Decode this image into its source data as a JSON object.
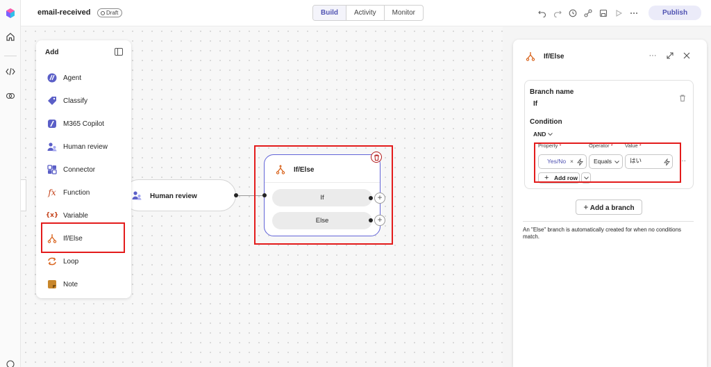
{
  "app": {
    "workflow_name": "email-received",
    "status_badge": "Draft"
  },
  "tabs": [
    {
      "label": "Build",
      "active": true
    },
    {
      "label": "Activity",
      "active": false
    },
    {
      "label": "Monitor",
      "active": false
    }
  ],
  "toolbar": {
    "publish_label": "Publish",
    "icons": [
      "undo-icon",
      "redo-icon",
      "history-icon",
      "connections-icon",
      "save-icon",
      "run-icon",
      "more-icon"
    ]
  },
  "rail": {
    "icons": [
      "app-logo-icon",
      "home-icon",
      "code-icon",
      "library-icon",
      "globe-icon"
    ]
  },
  "add_panel": {
    "title": "Add",
    "items": [
      {
        "label": "Agent",
        "icon": "agent-icon"
      },
      {
        "label": "Classify",
        "icon": "classify-icon"
      },
      {
        "label": "M365 Copilot",
        "icon": "copilot-icon"
      },
      {
        "label": "Human review",
        "icon": "human-review-icon"
      },
      {
        "label": "Connector",
        "icon": "connector-icon"
      },
      {
        "label": "Function",
        "icon": "function-icon"
      },
      {
        "label": "Variable",
        "icon": "variable-icon"
      },
      {
        "label": "If/Else",
        "icon": "branch-icon"
      },
      {
        "label": "Loop",
        "icon": "loop-icon"
      },
      {
        "label": "Note",
        "icon": "note-icon"
      }
    ]
  },
  "canvas": {
    "human_review_node": {
      "label": "Human review"
    },
    "ifelse_node": {
      "title": "If/Else",
      "branches": [
        "If",
        "Else"
      ]
    }
  },
  "properties_panel": {
    "title": "If/Else",
    "branch_name_label": "Branch name",
    "branch_name_value": "If",
    "condition_label": "Condition",
    "logic_operator": "AND",
    "columns": {
      "property": "Property",
      "operator": "Operator",
      "value": "Value"
    },
    "row": {
      "property": "Yes/No",
      "operator": "Equals",
      "value": "はい"
    },
    "add_row_label": "Add row",
    "add_branch_label": "Add a branch",
    "note": "An \"Else\" branch is automatically created for when no conditions match."
  },
  "colors": {
    "accent": "#4f52b2",
    "node_border": "#6264d8",
    "highlight": "#e31b1b",
    "ifelse_icon": "#d9651f"
  }
}
